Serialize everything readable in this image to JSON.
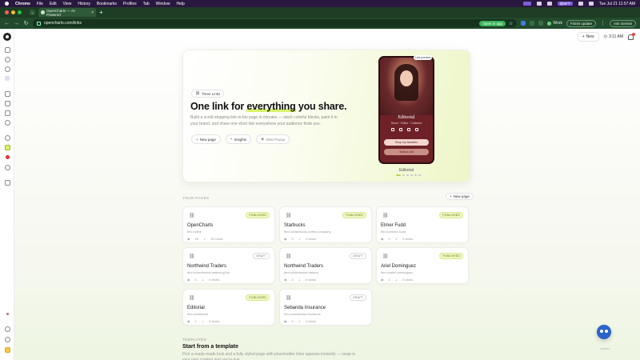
{
  "menubar": {
    "app": "Chrome",
    "items": [
      "File",
      "Edit",
      "View",
      "History",
      "Bookmarks",
      "Profiles",
      "Tab",
      "Window",
      "Help"
    ],
    "status_chip": "@SFT",
    "datetime": "Tue Jul 21  11:57 AM"
  },
  "browser": {
    "tab_title": "OpenCharts — AI-Powered",
    "url": "opencharts.com/links",
    "open_in_app": "Open in app",
    "profile": "Work",
    "finish_update": "Finish update",
    "ask_gemini": "Ask Gemini"
  },
  "topbar": {
    "new_label": "New",
    "timer": "3:11 AM"
  },
  "hero": {
    "pill_label": "Three Links",
    "title_pre": "One link for ",
    "title_highlight": "everything",
    "title_post": " you share.",
    "subtitle": "Build a scroll-stopping link-in-bio page in minutes — stack colorful blocks, paint it in your brand, and share one short link everywhere your audience finds you.",
    "btn_new_page": "New page",
    "btn_insights": "Insights",
    "btn_view_popup": "View Popup",
    "preview_badge": "Live preview",
    "phone": {
      "name": "Editorial",
      "tags": "Room · Editor · Collector",
      "button1": "Shop my favorites",
      "button2": "Book a call"
    },
    "theme_label": "Editorial"
  },
  "pages_section": {
    "label": "YOUR PAGES",
    "new_page": "New page",
    "cards": [
      {
        "title": "OpenCharts",
        "url": "flex.to/link",
        "views": "28",
        "clicks": "26 clicks",
        "status": "PUBLISHED"
      },
      {
        "title": "Starbucks",
        "url": "flex.to/starbucks-coffee-company",
        "views": "0",
        "clicks": "0 clicks",
        "status": "PUBLISHED"
      },
      {
        "title": "Elmer Fudd",
        "url": "flex.to/elmer-fudd",
        "views": "0",
        "clicks": "0 clicks",
        "status": "PUBLISHED"
      },
      {
        "title": "Northwind Traders",
        "url": "flex.to/northwind-traders-g2xe",
        "views": "0",
        "clicks": "0 clicks",
        "status": "DRAFT"
      },
      {
        "title": "Northwind Traders",
        "url": "flex.to/northwind-traders",
        "views": "0",
        "clicks": "0 clicks",
        "status": "DRAFT"
      },
      {
        "title": "Ariel Dominguez",
        "url": "flex.to/ariel-dominguez",
        "views": "0",
        "clicks": "0 clicks",
        "status": "PUBLISHED"
      },
      {
        "title": "Editorial",
        "url": "flex.to/editorial",
        "views": "1",
        "clicks": "0 clicks",
        "status": "PUBLISHED"
      },
      {
        "title": "Sebanda Insurance",
        "url": "flex.to/sebanda-insurance",
        "views": "0",
        "clicks": "0 clicks",
        "status": "DRAFT"
      }
    ]
  },
  "templates_section": {
    "label": "TEMPLATES",
    "title": "Start from a template",
    "subtitle": "Pick a ready-made look and a fully styled page with placeholder links appears instantly — swap in your own content and you're live."
  },
  "colors": {
    "accent": "#d8f26b",
    "chrome_dark": "#1d3d24",
    "menubar": "#2a1740"
  }
}
